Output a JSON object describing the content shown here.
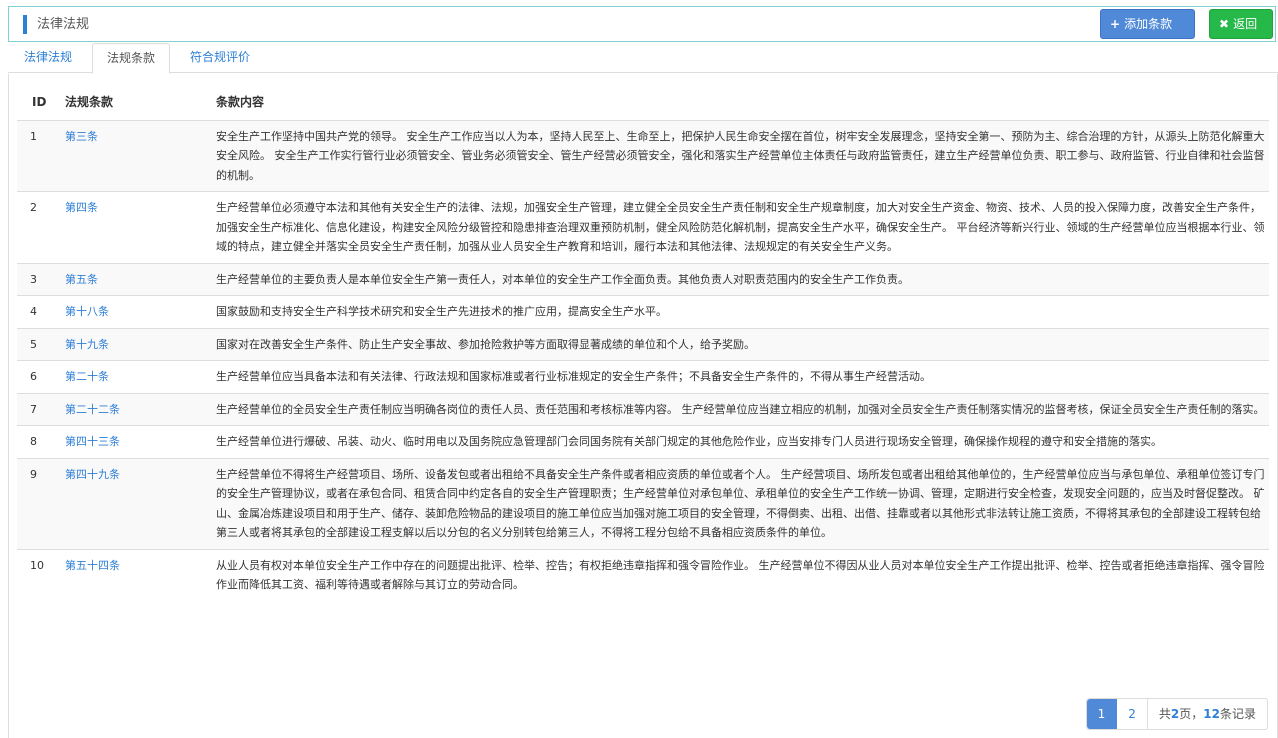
{
  "header": {
    "title": "法律法规",
    "add_button": "添加条款",
    "add_icon": "+",
    "back_button": "返回",
    "back_icon": "✖"
  },
  "tabs": [
    {
      "label": "法律法规"
    },
    {
      "label": "法规条款"
    },
    {
      "label": "符合规评价"
    }
  ],
  "table": {
    "columns": [
      "ID",
      "法规条款",
      "条款内容"
    ],
    "rows": [
      {
        "id": "1",
        "clause": "第三条",
        "content": "安全生产工作坚持中国共产党的领导。 安全生产工作应当以人为本，坚持人民至上、生命至上，把保护人民生命安全摆在首位，树牢安全发展理念，坚持安全第一、预防为主、综合治理的方针，从源头上防范化解重大安全风险。 安全生产工作实行管行业必须管安全、管业务必须管安全、管生产经营必须管安全，强化和落实生产经营单位主体责任与政府监管责任，建立生产经营单位负责、职工参与、政府监管、行业自律和社会监督的机制。"
      },
      {
        "id": "2",
        "clause": "第四条",
        "content": "生产经营单位必须遵守本法和其他有关安全生产的法律、法规，加强安全生产管理，建立健全全员安全生产责任制和安全生产规章制度，加大对安全生产资金、物资、技术、人员的投入保障力度，改善安全生产条件，加强安全生产标准化、信息化建设，构建安全风险分级管控和隐患排查治理双重预防机制，健全风险防范化解机制，提高安全生产水平，确保安全生产。 平台经济等新兴行业、领域的生产经营单位应当根据本行业、领域的特点，建立健全并落实全员安全生产责任制，加强从业人员安全生产教育和培训，履行本法和其他法律、法规规定的有关安全生产义务。"
      },
      {
        "id": "3",
        "clause": "第五条",
        "content": "生产经营单位的主要负责人是本单位安全生产第一责任人，对本单位的安全生产工作全面负责。其他负责人对职责范围内的安全生产工作负责。"
      },
      {
        "id": "4",
        "clause": "第十八条",
        "content": "国家鼓励和支持安全生产科学技术研究和安全生产先进技术的推广应用，提高安全生产水平。"
      },
      {
        "id": "5",
        "clause": "第十九条",
        "content": "国家对在改善安全生产条件、防止生产安全事故、参加抢险救护等方面取得显著成绩的单位和个人，给予奖励。"
      },
      {
        "id": "6",
        "clause": "第二十条",
        "content": "生产经营单位应当具备本法和有关法律、行政法规和国家标准或者行业标准规定的安全生产条件；不具备安全生产条件的，不得从事生产经营活动。"
      },
      {
        "id": "7",
        "clause": "第二十二条",
        "content": "生产经营单位的全员安全生产责任制应当明确各岗位的责任人员、责任范围和考核标准等内容。 生产经营单位应当建立相应的机制，加强对全员安全生产责任制落实情况的监督考核，保证全员安全生产责任制的落实。"
      },
      {
        "id": "8",
        "clause": "第四十三条",
        "content": "生产经营单位进行爆破、吊装、动火、临时用电以及国务院应急管理部门会同国务院有关部门规定的其他危险作业，应当安排专门人员进行现场安全管理，确保操作规程的遵守和安全措施的落实。"
      },
      {
        "id": "9",
        "clause": "第四十九条",
        "content": "生产经营单位不得将生产经营项目、场所、设备发包或者出租给不具备安全生产条件或者相应资质的单位或者个人。 生产经营项目、场所发包或者出租给其他单位的，生产经营单位应当与承包单位、承租单位签订专门的安全生产管理协议，或者在承包合同、租赁合同中约定各自的安全生产管理职责；生产经营单位对承包单位、承租单位的安全生产工作统一协调、管理，定期进行安全检查，发现安全问题的，应当及时督促整改。 矿山、金属冶炼建设项目和用于生产、储存、装卸危险物品的建设项目的施工单位应当加强对施工项目的安全管理，不得倒卖、出租、出借、挂靠或者以其他形式非法转让施工资质，不得将其承包的全部建设工程转包给第三人或者将其承包的全部建设工程支解以后以分包的名义分别转包给第三人，不得将工程分包给不具备相应资质条件的单位。"
      },
      {
        "id": "10",
        "clause": "第五十四条",
        "content": "从业人员有权对本单位安全生产工作中存在的问题提出批评、检举、控告；有权拒绝违章指挥和强令冒险作业。 生产经营单位不得因从业人员对本单位安全生产工作提出批评、检举、控告或者拒绝违章指挥、强令冒险作业而降低其工资、福利等待遇或者解除与其订立的劳动合同。"
      }
    ]
  },
  "pagination": {
    "pages": [
      "1",
      "2"
    ],
    "current": "1",
    "info_prefix": "共",
    "total_pages": "2",
    "info_mid": "页，",
    "total_records": "12",
    "info_suffix": "条记录"
  },
  "colors": {
    "accent": "#2e7fd6",
    "add_button": "#4f89d8",
    "back_button": "#27b84a",
    "header_border": "#7fd3d6"
  }
}
